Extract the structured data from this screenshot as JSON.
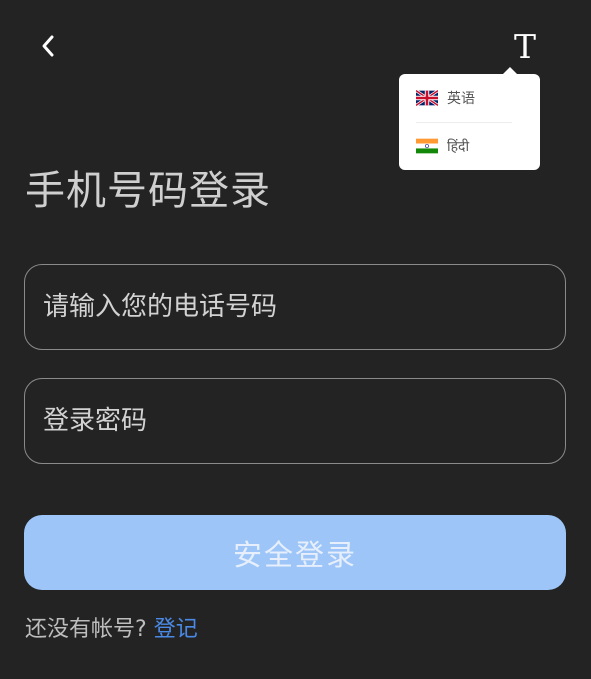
{
  "header": {
    "back_icon": "chevron-left-icon",
    "language_toggle_icon": "T"
  },
  "language_menu": {
    "items": [
      {
        "label": "英语",
        "flag": "uk-flag-icon"
      },
      {
        "label": "हिंदी",
        "flag": "india-flag-icon"
      }
    ]
  },
  "title": "手机号码登录",
  "form": {
    "phone_placeholder": "请输入您的电话号码",
    "password_placeholder": "登录密码",
    "submit_label": "安全登录"
  },
  "footer": {
    "prompt": "还没有帐号?",
    "register_label": "登记"
  },
  "colors": {
    "background": "#232323",
    "primary_button": "#9dc5f7",
    "link": "#4a8ae6"
  }
}
